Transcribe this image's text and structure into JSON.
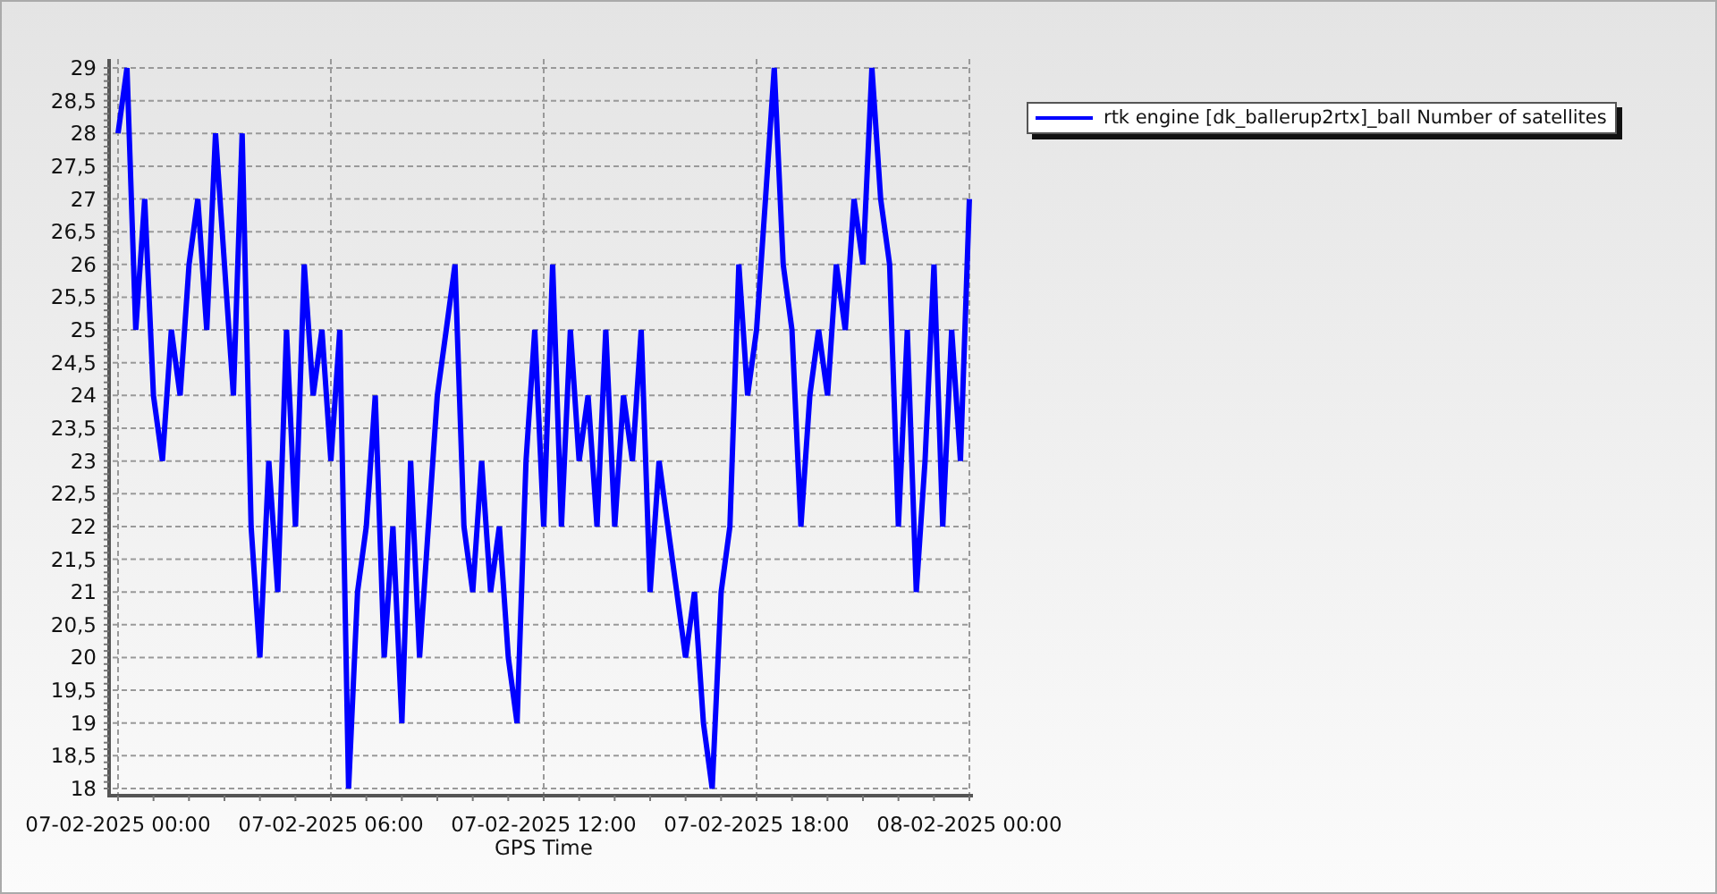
{
  "chart_data": {
    "type": "line",
    "grid": true,
    "xlabel": "GPS Time",
    "ylim": [
      18,
      29
    ],
    "yticks": [
      18,
      {
        "value": 18.5,
        "label": "18,5"
      },
      19,
      {
        "value": 19.5,
        "label": "19,5"
      },
      20,
      {
        "value": 20.5,
        "label": "20,5"
      },
      21,
      {
        "value": 21.5,
        "label": "21,5"
      },
      22,
      {
        "value": 22.5,
        "label": "22,5"
      },
      23,
      {
        "value": 23.5,
        "label": "23,5"
      },
      24,
      {
        "value": 24.5,
        "label": "24,5"
      },
      25,
      {
        "value": 25.5,
        "label": "25,5"
      },
      26,
      {
        "value": 26.5,
        "label": "26,5"
      },
      27,
      {
        "value": 27.5,
        "label": "27,5"
      },
      28,
      {
        "value": 28.5,
        "label": "28,5"
      },
      29
    ],
    "categories": [
      "07-02-2025 00:00",
      null,
      null,
      null,
      null,
      null,
      null,
      null,
      null,
      null,
      null,
      null,
      null,
      null,
      null,
      null,
      null,
      null,
      null,
      null,
      null,
      null,
      null,
      null,
      "07-02-2025 06:00",
      null,
      null,
      null,
      null,
      null,
      null,
      null,
      null,
      null,
      null,
      null,
      null,
      null,
      null,
      null,
      null,
      null,
      null,
      null,
      null,
      null,
      null,
      null,
      "07-02-2025 12:00",
      null,
      null,
      null,
      null,
      null,
      null,
      null,
      null,
      null,
      null,
      null,
      null,
      null,
      null,
      null,
      null,
      null,
      null,
      null,
      null,
      null,
      null,
      null,
      "07-02-2025 18:00",
      null,
      null,
      null,
      null,
      null,
      null,
      null,
      null,
      null,
      null,
      null,
      null,
      null,
      null,
      null,
      null,
      null,
      null,
      null,
      null,
      null,
      null,
      null,
      "08-02-2025 00:00"
    ],
    "series": [
      {
        "name": "rtk engine [dk_ballerup2rtx]_ball Number of satellites",
        "color": "#0000ff",
        "values": [
          28,
          29,
          25,
          27,
          24,
          23,
          25,
          24,
          26,
          27,
          25,
          28,
          26,
          24,
          28,
          22,
          20,
          23,
          21,
          25,
          22,
          26,
          24,
          25,
          23,
          25,
          18,
          21,
          22,
          24,
          20,
          22,
          19,
          23,
          20,
          22,
          24,
          25,
          26,
          22,
          21,
          23,
          21,
          22,
          20,
          19,
          23,
          25,
          22,
          26,
          22,
          25,
          23,
          24,
          22,
          25,
          22,
          24,
          23,
          25,
          21,
          23,
          22,
          21,
          20,
          21,
          19,
          18,
          21,
          22,
          26,
          24,
          25,
          27,
          29,
          26,
          25,
          22,
          24,
          25,
          24,
          26,
          25,
          27,
          26,
          29,
          27,
          26,
          22,
          25,
          21,
          23,
          26,
          22,
          25,
          23,
          27
        ]
      }
    ]
  }
}
